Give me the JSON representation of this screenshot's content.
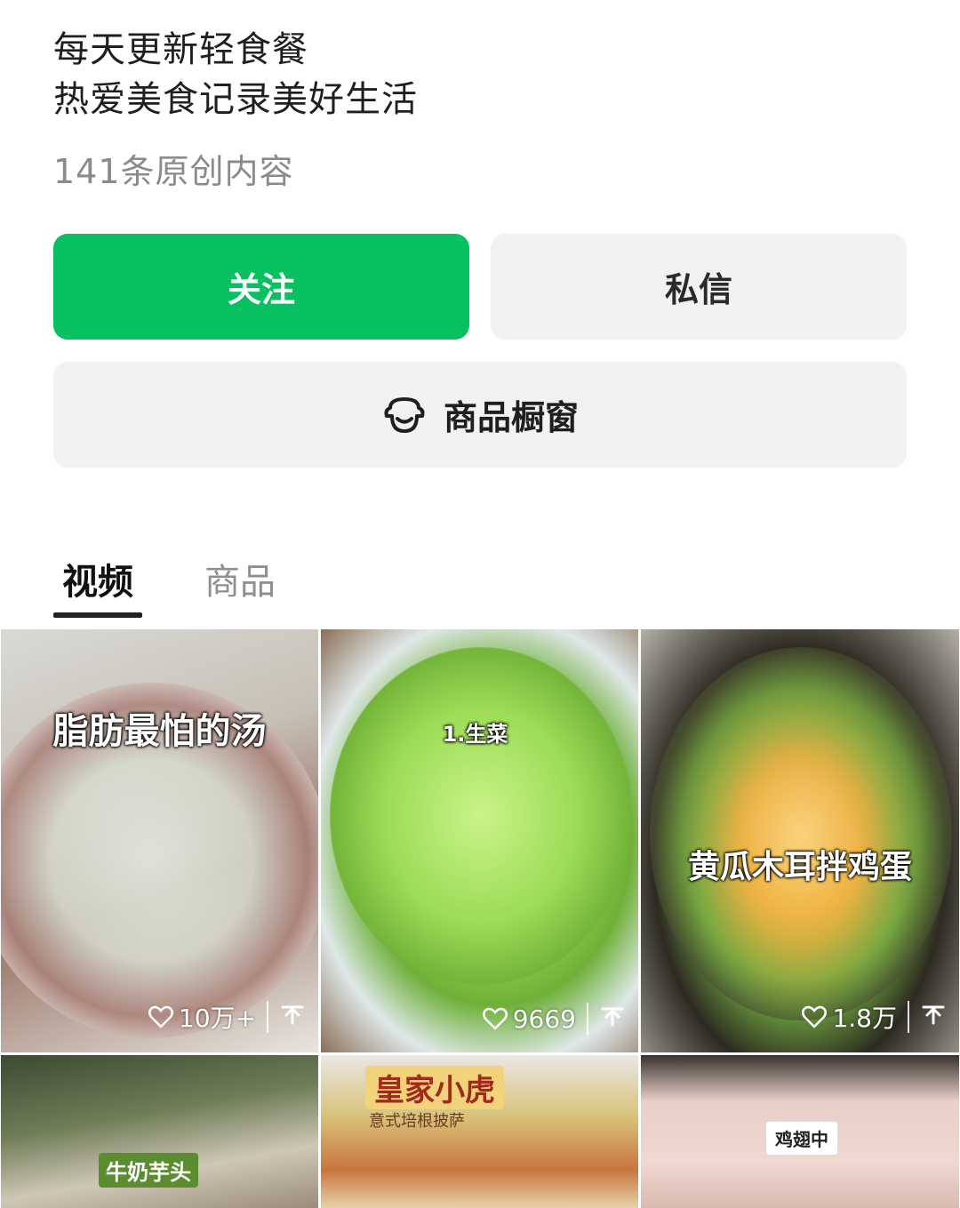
{
  "profile": {
    "bio_lines": [
      "每天更新轻食餐",
      "热爱美食记录美好生活"
    ],
    "original_count": "141条原创内容"
  },
  "actions": {
    "follow_label": "关注",
    "message_label": "私信",
    "shop_label": "商品橱窗",
    "shop_icon": "storefront-icon"
  },
  "tabs": [
    {
      "label": "视频",
      "active": true
    },
    {
      "label": "商品",
      "active": false
    }
  ],
  "videos": [
    {
      "cover_title": "脂肪最怕的汤",
      "likes": "10万+"
    },
    {
      "cover_title": "1.生菜",
      "likes": "9669"
    },
    {
      "cover_title": "黄瓜木耳拌鸡蛋",
      "likes": "1.8万"
    },
    {
      "cover_title": "牛奶芋头"
    },
    {
      "cover_title": "皇家小虎",
      "cover_subtitle": "意式培根披萨"
    },
    {
      "cover_title": "鸡翅中"
    }
  ],
  "colors": {
    "follow_button": "#07c160",
    "secondary_button": "#f2f2f2",
    "muted_text": "#8a8a8a"
  }
}
